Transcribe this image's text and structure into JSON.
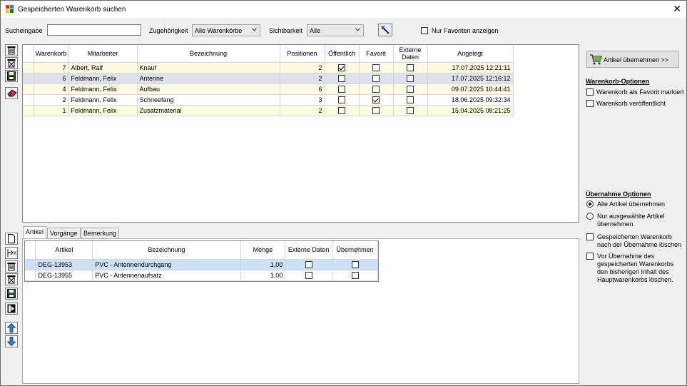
{
  "window": {
    "title": "Gespeicherten Warenkorb suchen"
  },
  "filter": {
    "search_label": "Sucheingabe",
    "search_value": "",
    "zugehoerigkeit_label": "Zugehörigkeit",
    "zugehoerigkeit_value": "Alle Warenkörbe",
    "sichtbarkeit_label": "Sichtbarkeit",
    "sichtbarkeit_value": "Alle",
    "favoriten_label": "Nur Favoriten anzeigen",
    "favoriten_checked": false
  },
  "baskets": {
    "columns": [
      "Warenkorb",
      "Mitarbeiter",
      "Bezeichnung",
      "Positionen",
      "Öffentlich",
      "Favorit",
      "Externe Daten",
      "Angelegt"
    ],
    "rows": [
      {
        "warenkorb": "7",
        "mitarbeiter": "Albert, Ralf",
        "bezeichnung": "Knauf",
        "positionen": "2",
        "oeffentlich": true,
        "favorit": false,
        "extern": false,
        "angelegt": "17.07.2025 12:21:11"
      },
      {
        "warenkorb": "6",
        "mitarbeiter": "Feldmann, Felix",
        "bezeichnung": "Antenne",
        "positionen": "2",
        "oeffentlich": false,
        "favorit": false,
        "extern": false,
        "angelegt": "17.07.2025 12:16:12"
      },
      {
        "warenkorb": "4",
        "mitarbeiter": "Feldmann, Felix",
        "bezeichnung": "Aufbau",
        "positionen": "6",
        "oeffentlich": false,
        "favorit": false,
        "extern": false,
        "angelegt": "09.07.2025 10:44:41"
      },
      {
        "warenkorb": "2",
        "mitarbeiter": "Feldmann, Felix",
        "bezeichnung": "Schneefang",
        "positionen": "3",
        "oeffentlich": false,
        "favorit": true,
        "extern": false,
        "angelegt": "18.06.2025 09:32:34"
      },
      {
        "warenkorb": "1",
        "mitarbeiter": "Feldmann, Felix",
        "bezeichnung": "Zusatzmaterial",
        "positionen": "2",
        "oeffentlich": false,
        "favorit": false,
        "extern": false,
        "angelegt": "15.04.2025 08:21:25"
      }
    ]
  },
  "tabs": [
    "Artikel",
    "Vorgänge",
    "Bemerkung"
  ],
  "articles": {
    "columns": [
      "Artikel",
      "Bezeichnung",
      "Menge",
      "Externe Daten",
      "Übernehmen"
    ],
    "rows": [
      {
        "artikel": "DEG-13953",
        "bezeichnung": "PVC - Antennendurchgang",
        "menge": "1,00",
        "extern": false,
        "uebernehmen": false
      },
      {
        "artikel": "DEG-13955",
        "bezeichnung": "PVC - Antennenaufsatz",
        "menge": "1,00",
        "extern": false,
        "uebernehmen": false
      }
    ]
  },
  "right": {
    "take_button": "Artikel übernehmen >>",
    "options_header": "Warenkorb-Optionen",
    "opt_favorit": "Warenkorb als Favorit markiert",
    "opt_public": "Warenkorb veröffentlicht",
    "takeover_header": "Übernahme Optionen",
    "radio_all": "Alle Artikel übernehmen",
    "radio_selected_1": "Nur ausgewählte Artikel",
    "radio_selected_2": "übernehmen",
    "delete_after_1": "Gespeicherten Warenkorb",
    "delete_after_2": "nach der Übernahme löschen",
    "clear_before_1": "Vor Übernahme des",
    "clear_before_2": "gespeicherten Warenkorbs",
    "clear_before_3": "den bisherigen Inhalt des",
    "clear_before_4": "Hauptwarenkorbs löschen."
  },
  "colors": {
    "odd_row": "#fdfbe2",
    "selected_row": "#dfe2ea",
    "selected_article": "#cce0fa"
  }
}
